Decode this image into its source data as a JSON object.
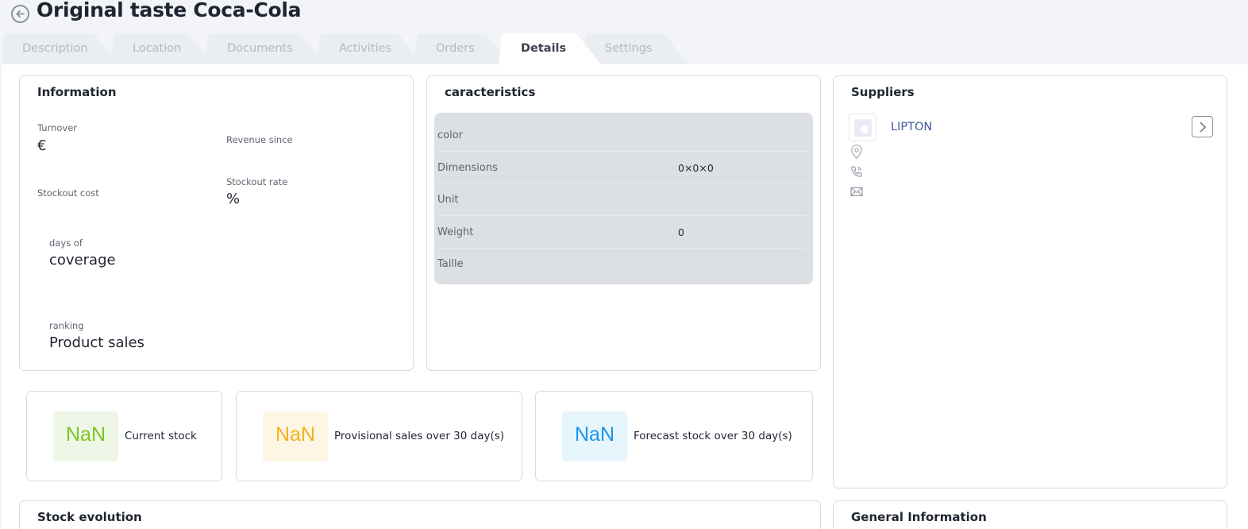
{
  "header": {
    "title": "Original taste Coca-Cola"
  },
  "tabs": [
    {
      "label": "Description",
      "active": false
    },
    {
      "label": "Location",
      "active": false
    },
    {
      "label": "Documents",
      "active": false
    },
    {
      "label": "Activities",
      "active": false
    },
    {
      "label": "Orders",
      "active": false
    },
    {
      "label": "Details",
      "active": true
    },
    {
      "label": "Settings",
      "active": false
    }
  ],
  "information": {
    "title": "Information",
    "turnover_label": "Turnover",
    "turnover_value": "€",
    "revenue_label": "Revenue since",
    "stockout_cost_label": "Stockout cost",
    "stockout_rate_label": "Stockout rate",
    "stockout_rate_value": "%",
    "days_label": "days of",
    "days_value": "coverage",
    "ranking_label": "ranking",
    "ranking_value": "Product sales"
  },
  "characteristics": {
    "title": "caracteristics",
    "rows": [
      {
        "label": "color",
        "value": ""
      },
      {
        "label": "Dimensions",
        "value": "0×0×0"
      },
      {
        "label": "Unit",
        "value": ""
      },
      {
        "label": "Weight",
        "value": "0"
      },
      {
        "label": "Taille",
        "value": ""
      }
    ]
  },
  "suppliers": {
    "title": "Suppliers",
    "items": [
      {
        "name": "LIPTON"
      }
    ]
  },
  "stats": [
    {
      "value": "NaN",
      "label": "Current stock",
      "color": "#7cc520",
      "bg": "#eef6e7"
    },
    {
      "value": "NaN",
      "label": "Provisional sales over 30 day(s)",
      "color": "#f2b21a",
      "bg": "#fdf6e4"
    },
    {
      "value": "NaN",
      "label": "Forecast stock over 30 day(s)",
      "color": "#1a94ea",
      "bg": "#e7f5fc"
    }
  ],
  "sections": {
    "stock_evolution": "Stock evolution",
    "general_information": "General Information"
  },
  "icons": {
    "back": "back-arrow-circle-icon",
    "location": "location-pin-icon",
    "phone": "phone-icon",
    "email": "envelope-icon",
    "chevron": "chevron-right-icon"
  }
}
